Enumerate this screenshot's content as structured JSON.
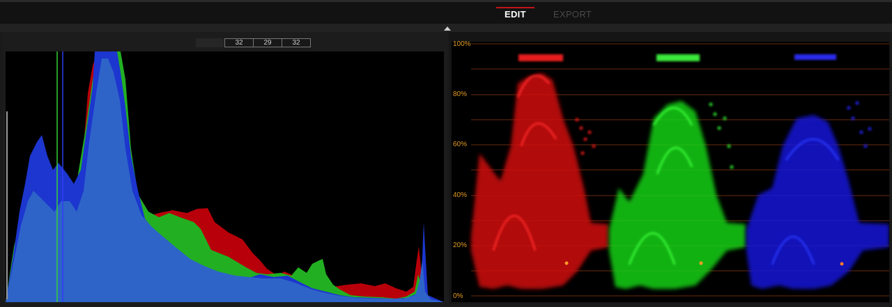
{
  "tabs": [
    {
      "label": "EDIT",
      "active": true
    },
    {
      "label": "EXPORT",
      "active": false
    }
  ],
  "histogram": {
    "probe_values": [
      "32",
      "29",
      "32"
    ],
    "channel_colors": {
      "red": "#c0000a",
      "green": "#1fb51f",
      "blue": "#1a3ad6",
      "overlap": "#2e64c8"
    }
  },
  "parade": {
    "y_labels": [
      "100%",
      "80%",
      "60%",
      "40%",
      "20%",
      "0%"
    ],
    "channels": [
      "red",
      "green",
      "blue"
    ],
    "gridline_color": "#6a2c0c",
    "label_color": "#e39b22"
  }
}
